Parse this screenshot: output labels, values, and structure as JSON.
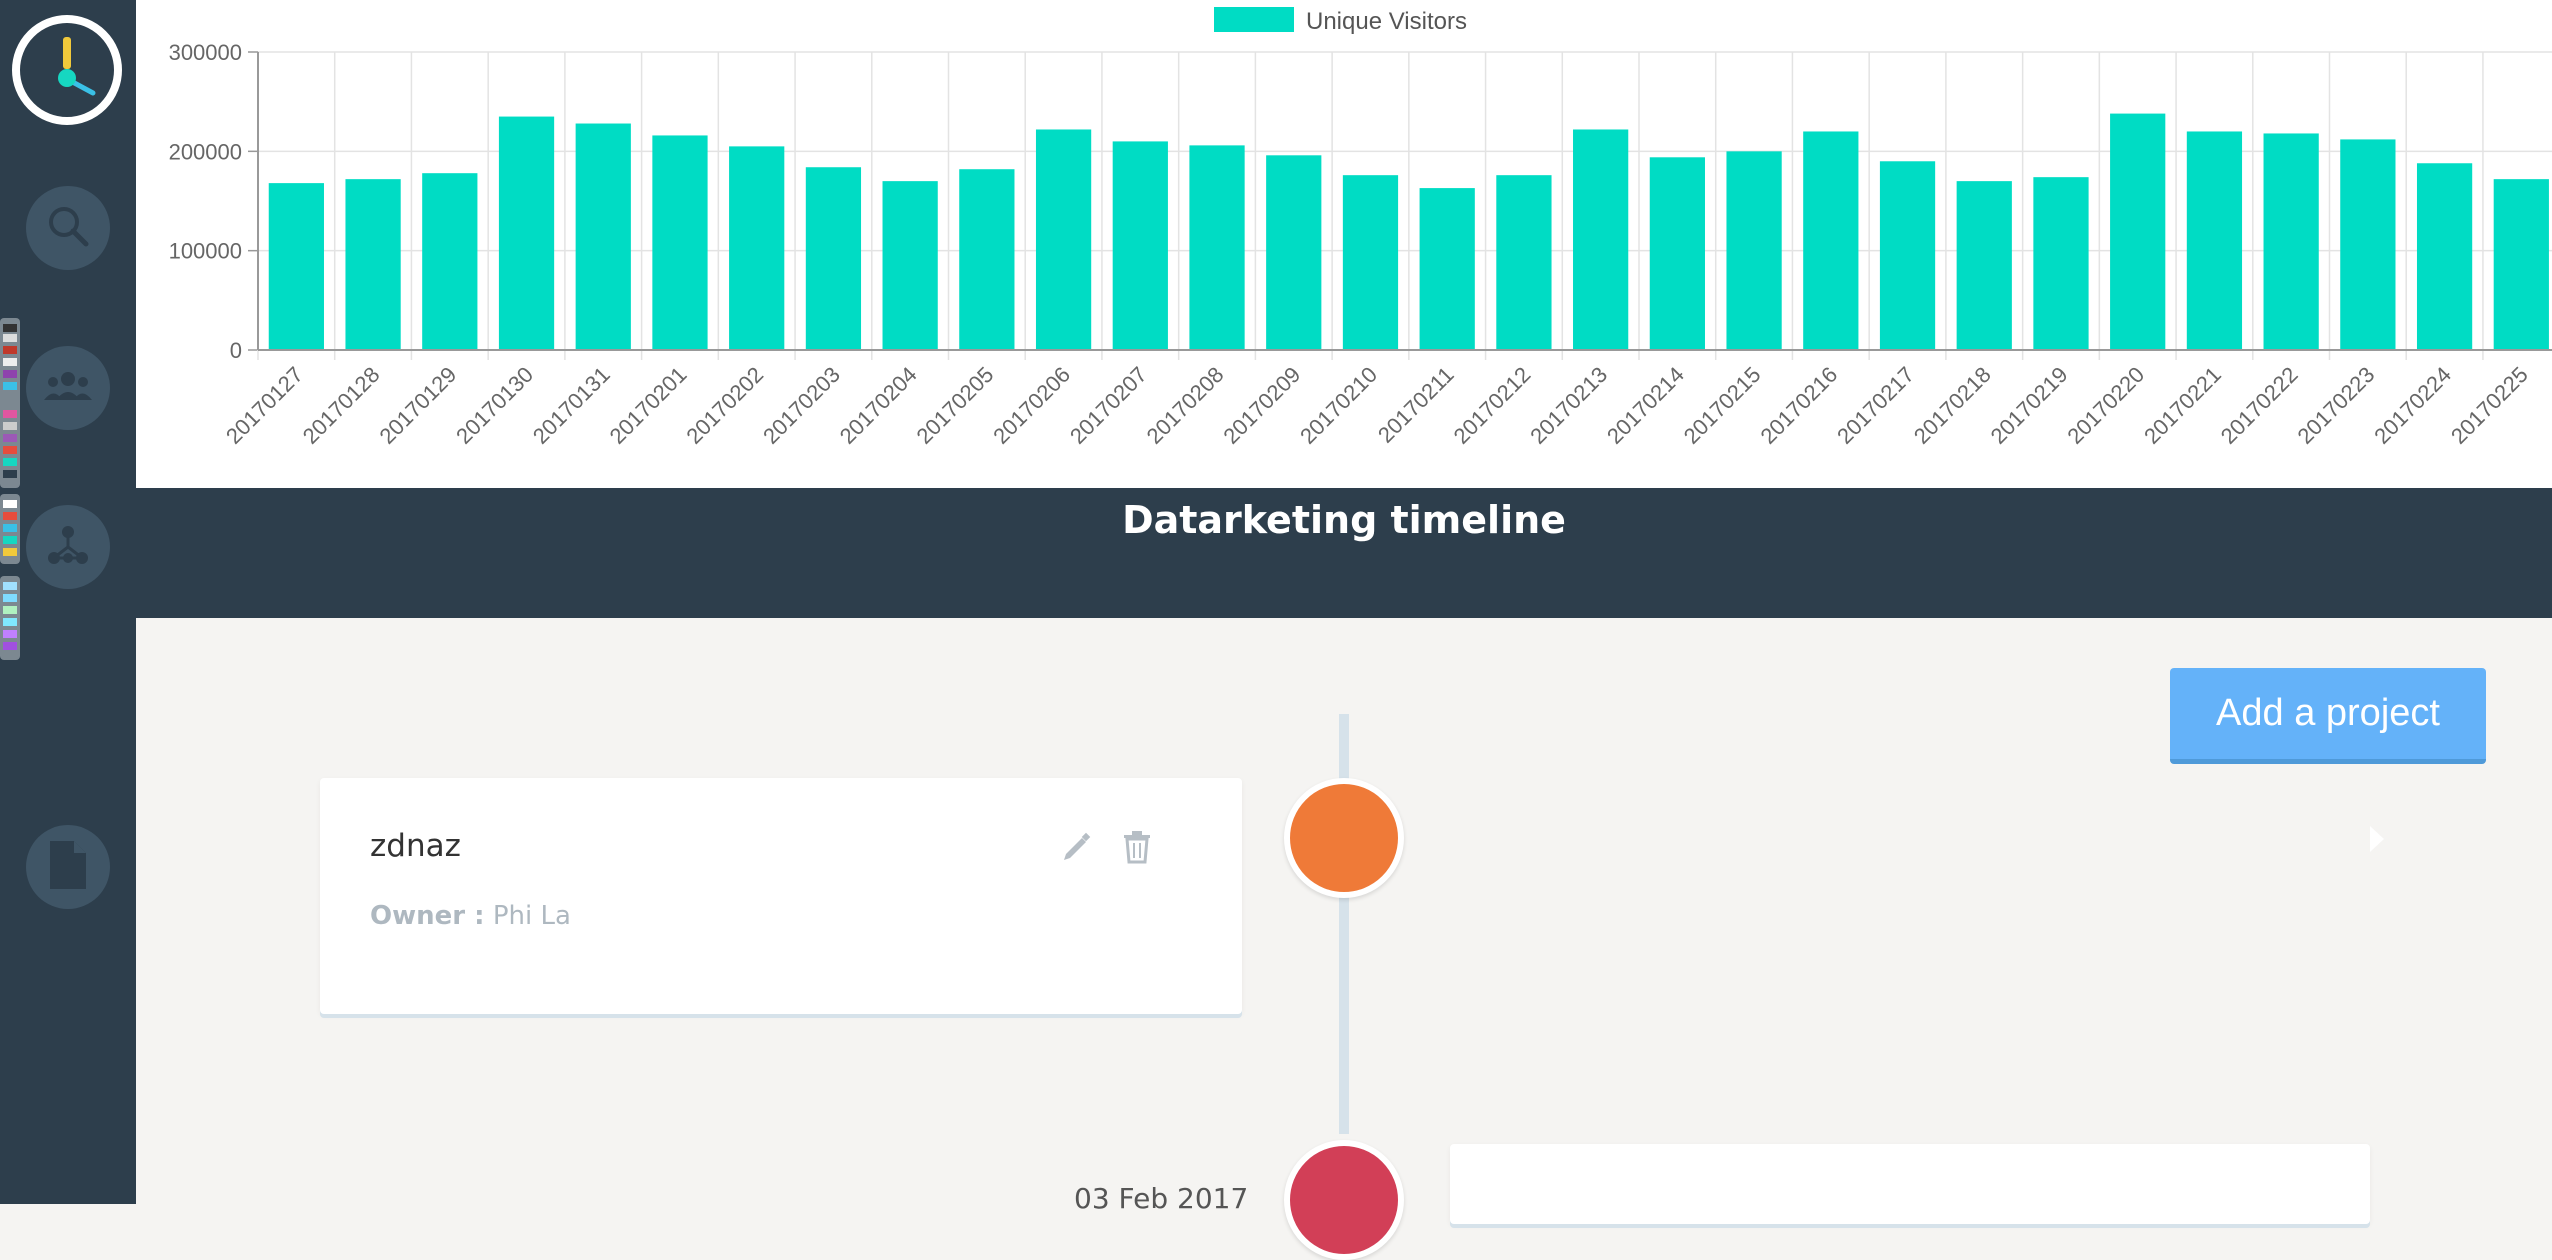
{
  "sidebar": {
    "items": [
      {
        "name": "search",
        "icon": "search-icon"
      },
      {
        "name": "users",
        "icon": "users-icon"
      },
      {
        "name": "network",
        "icon": "network-icon"
      },
      {
        "name": "document",
        "icon": "document-icon"
      }
    ]
  },
  "chart_data": {
    "type": "bar",
    "categories": [
      "20170127",
      "20170128",
      "20170129",
      "20170130",
      "20170131",
      "20170201",
      "20170202",
      "20170203",
      "20170204",
      "20170205",
      "20170206",
      "20170207",
      "20170208",
      "20170209",
      "20170210",
      "20170211",
      "20170212",
      "20170213",
      "20170214",
      "20170215",
      "20170216",
      "20170217",
      "20170218",
      "20170219",
      "20170220",
      "20170221",
      "20170222",
      "20170223",
      "20170224",
      "20170225"
    ],
    "series": [
      {
        "name": "Unique Visitors",
        "color": "#00dcc4",
        "values": [
          168000,
          172000,
          178000,
          235000,
          228000,
          216000,
          205000,
          184000,
          170000,
          182000,
          222000,
          210000,
          206000,
          196000,
          176000,
          163000,
          176000,
          222000,
          194000,
          200000,
          220000,
          190000,
          170000,
          174000,
          238000,
          220000,
          218000,
          212000,
          188000,
          172000
        ]
      }
    ],
    "ylim": [
      0,
      300000
    ],
    "yticks": [
      "0",
      "100000",
      "200000",
      "300000"
    ],
    "legend": "top-center",
    "grid": true
  },
  "timeline": {
    "title": "Datarketing timeline",
    "add_button": "Add a project",
    "items": [
      {
        "title": "zdnaz",
        "owner_label": "Owner :",
        "owner": "Phi La",
        "dot_color": "#ef7a38"
      },
      {
        "date": "03 Feb 2017",
        "dot_color": "#d23f57"
      }
    ]
  },
  "colors": {
    "sidebar": "#2d3e4c",
    "accent_button": "#64b2f9",
    "bars": "#00dcc4"
  }
}
